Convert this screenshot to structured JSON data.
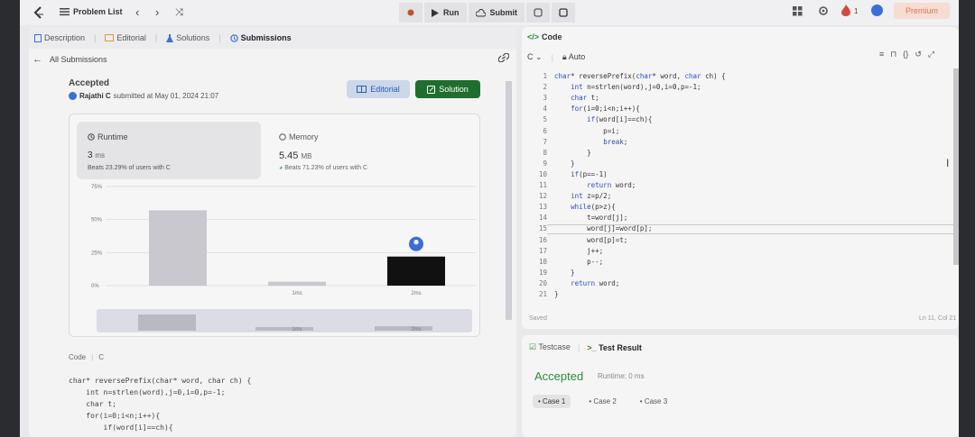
{
  "topbar": {
    "problem_list": "Problem List",
    "run": "Run",
    "submit": "Submit",
    "streak_count": "1",
    "premium": "Premium"
  },
  "left": {
    "tabs": [
      "Description",
      "Editorial",
      "Solutions",
      "Submissions"
    ],
    "back_label": "All Submissions",
    "status": "Accepted",
    "author": "Rajathi C",
    "submitted_text": "submitted at May 01, 2024 21:07",
    "editorial_btn": "Editorial",
    "solution_btn": "Solution",
    "runtime": {
      "label": "Runtime",
      "value": "3",
      "unit": "ms",
      "beats": "Beats 23.29% of users with C"
    },
    "memory": {
      "label": "Memory",
      "value": "5.45",
      "unit": "MB",
      "beats": "Beats 71.23% of users with C"
    },
    "code_label": "Code",
    "code_lang": "C",
    "code_lines": [
      "char* reversePrefix(char* word, char ch) {",
      "    int n=strlen(word),j=0,i=0,p=-1;",
      "    char t;",
      "    for(i=0;i<n;i++){",
      "        if(word[i]==ch){"
    ]
  },
  "chart_data": {
    "type": "bar",
    "categories": [
      "",
      "1ms",
      "2ms"
    ],
    "values": [
      57,
      3,
      22
    ],
    "x_ticks": [
      "1ms",
      "2ms"
    ],
    "y_ticks": [
      "75%",
      "50%",
      "25%",
      "0%"
    ],
    "ylim": [
      0,
      75
    ],
    "highlight_index": 2,
    "colors": {
      "bar": "#c8c8ce",
      "highlight": "#111111",
      "marker": "#3a6fd8"
    },
    "slider_ticks": [
      "1ms",
      "2ms"
    ]
  },
  "right": {
    "title": "Code",
    "lang": "C",
    "mode": "Auto",
    "code_lines": [
      "char* reversePrefix(char* word, char ch) {",
      "    int n=strlen(word),j=0,i=0,p=-1;",
      "    char t;",
      "    for(i=0;i<n;i++){",
      "        if(word[i]==ch){",
      "            p=i;",
      "            break;",
      "        }",
      "    }",
      "    if(p==-1)",
      "        return word;",
      "    int z=p/2;",
      "    while(p>z){",
      "        t=word[j];",
      "        word[j]=word[p];",
      "        word[p]=t;",
      "        j++;",
      "        p--;",
      "    }",
      "    return word;",
      "}"
    ],
    "saved": "Saved",
    "cursor_pos": "Ln 11, Col 21"
  },
  "testpanel": {
    "tabs": [
      "Testcase",
      "Test Result"
    ],
    "status": "Accepted",
    "runtime": "Runtime: 0 ms",
    "cases": [
      "Case 1",
      "Case 2",
      "Case 3"
    ]
  }
}
